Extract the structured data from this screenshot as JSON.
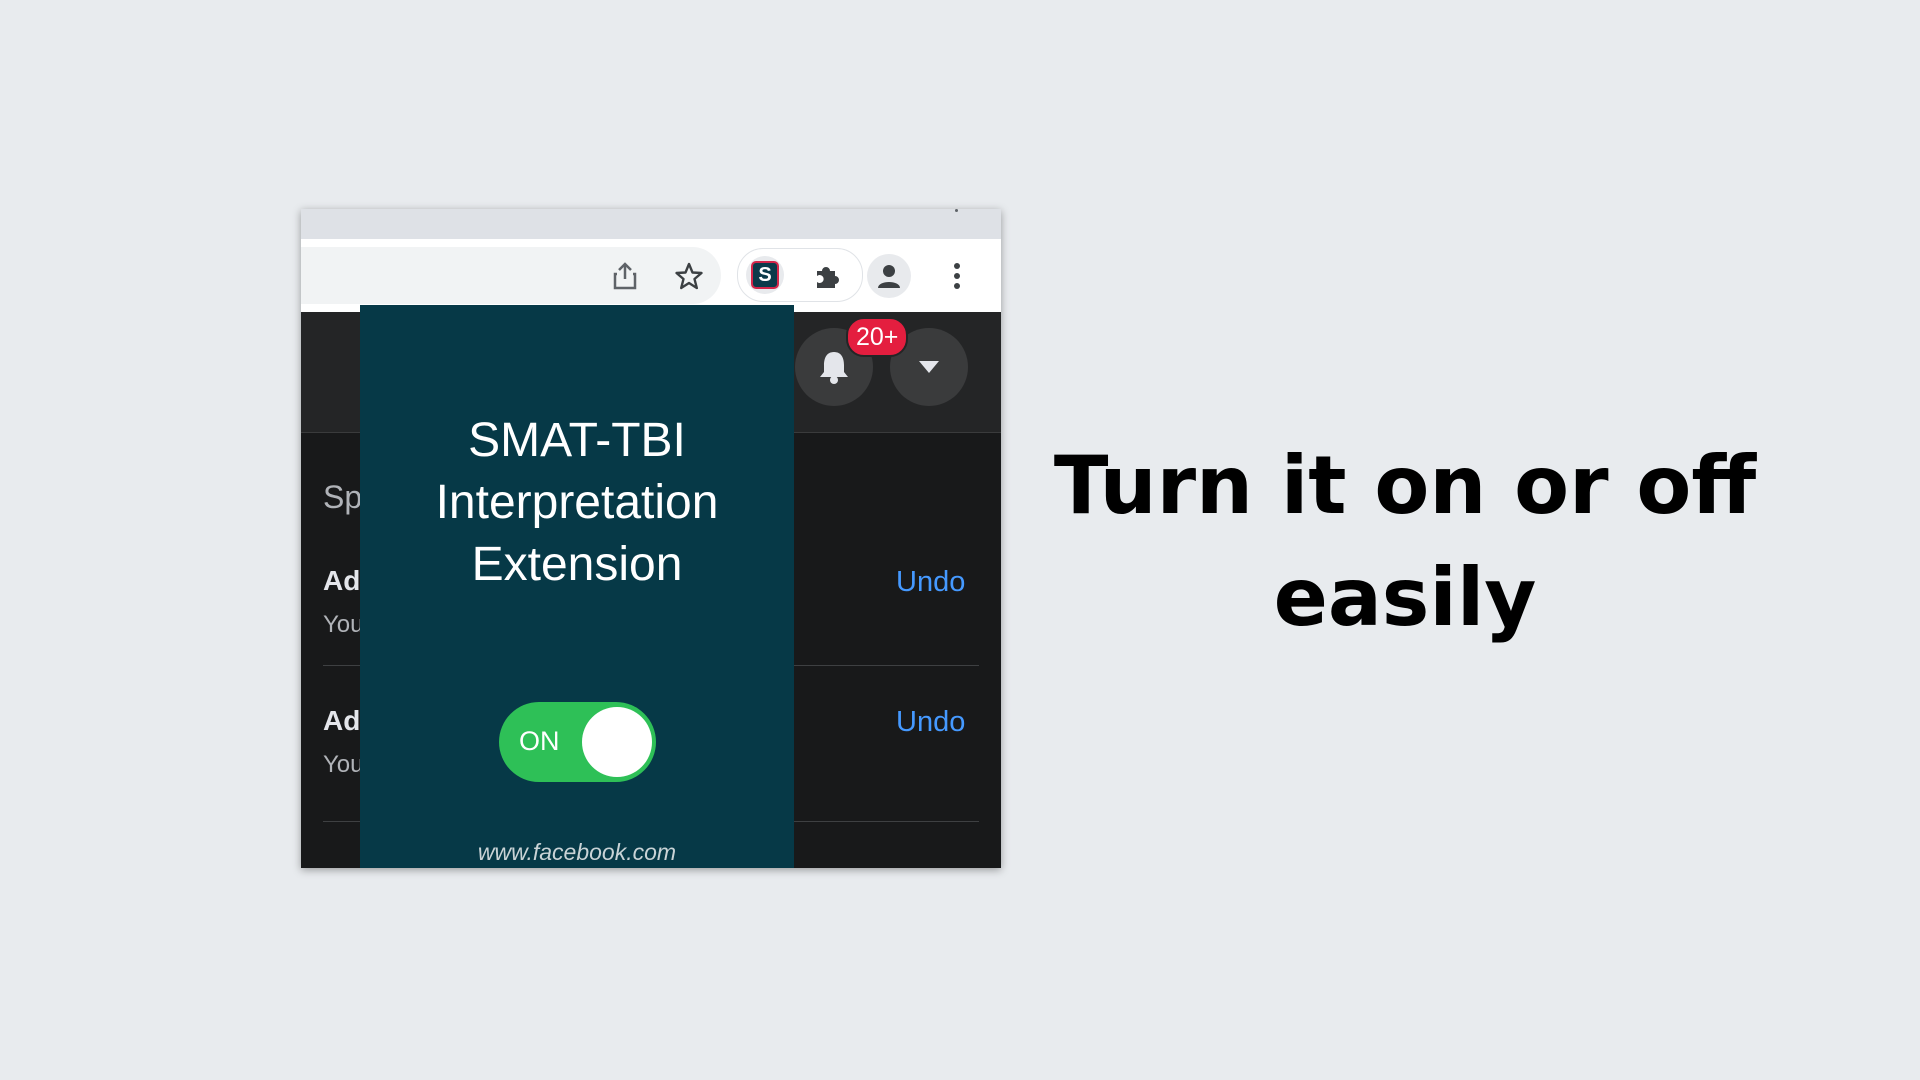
{
  "popup": {
    "title_lines": [
      "SMAT-TBI",
      "Interpretation",
      "Extension"
    ],
    "toggle_label": "ON",
    "toggle_state": "on",
    "site": "www.facebook.com"
  },
  "browser": {
    "extension_icon_letter": "S",
    "icons": [
      "share-icon",
      "star-icon",
      "extension-s-icon",
      "puzzle-icon",
      "profile-icon",
      "more-vert-icon"
    ]
  },
  "page": {
    "notification_badge": "20+",
    "sidebar": {
      "heading_fragment": "Sp",
      "items": [
        {
          "title_fragment": "Ad",
          "subtitle_fragment": "You",
          "action": "Undo"
        },
        {
          "title_fragment": "Ad",
          "subtitle_fragment": "You",
          "action": "Undo"
        }
      ]
    }
  },
  "headline": {
    "line1": "Turn it on or off",
    "line2": "easily"
  },
  "colors": {
    "background": "#e8ebee",
    "popup": "#063947",
    "toggle_on": "#2ec057",
    "badge": "#e41e3f",
    "link": "#4599ff"
  }
}
